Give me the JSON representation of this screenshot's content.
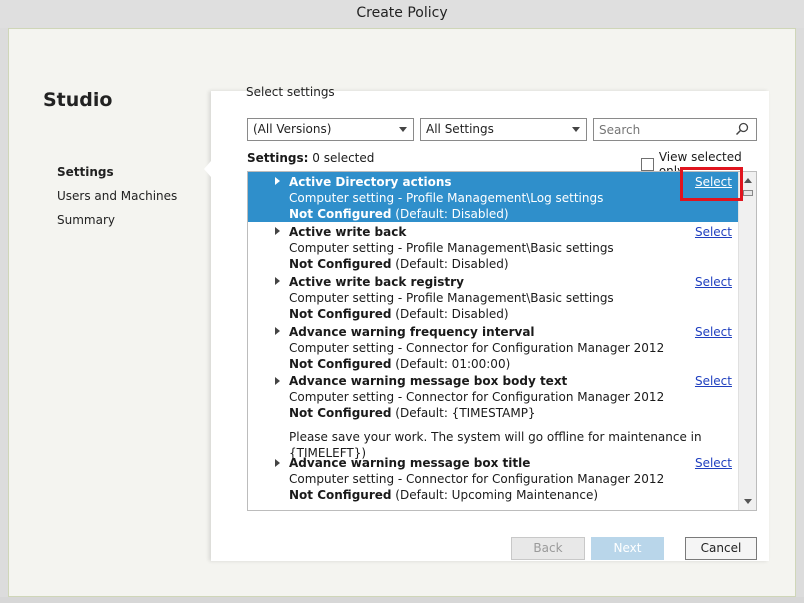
{
  "window": {
    "title": "Create Policy"
  },
  "brand": "Studio",
  "nav": [
    {
      "label": "Settings",
      "active": true
    },
    {
      "label": "Users and Machines",
      "active": false
    },
    {
      "label": "Summary",
      "active": false
    }
  ],
  "main": {
    "section_title": "Select settings",
    "filter_versions": "(All Versions)",
    "filter_settings": "All Settings",
    "search_placeholder": "Search",
    "settings_label": "Settings:",
    "settings_count": "0 selected",
    "view_selected_label": "View selected only",
    "select_link": "Select",
    "items": [
      {
        "name": "Active Directory actions",
        "setting": "Computer setting - Profile Management\\Log settings",
        "status": "Not Configured",
        "default": "(Default: Disabled)"
      },
      {
        "name": "Active write back",
        "setting": "Computer setting - Profile Management\\Basic settings",
        "status": "Not Configured",
        "default": "(Default: Disabled)"
      },
      {
        "name": "Active write back registry",
        "setting": "Computer setting - Profile Management\\Basic settings",
        "status": "Not Configured",
        "default": "(Default: Disabled)"
      },
      {
        "name": "Advance warning frequency interval",
        "setting": "Computer setting - Connector for Configuration Manager 2012",
        "status": "Not Configured",
        "default": "(Default: 01:00:00)"
      },
      {
        "name": "Advance warning message box body text",
        "setting": "Computer setting - Connector for Configuration Manager 2012",
        "status": "Not Configured",
        "default": "(Default: {TIMESTAMP}",
        "extra": "Please save your work. The system will go offline for maintenance in {TIMELEFT})"
      },
      {
        "name": "Advance warning message box title",
        "setting": "Computer setting - Connector for Configuration Manager 2012",
        "status": "Not Configured",
        "default": "(Default: Upcoming Maintenance)"
      }
    ]
  },
  "buttons": {
    "back": "Back",
    "next": "Next",
    "cancel": "Cancel"
  }
}
